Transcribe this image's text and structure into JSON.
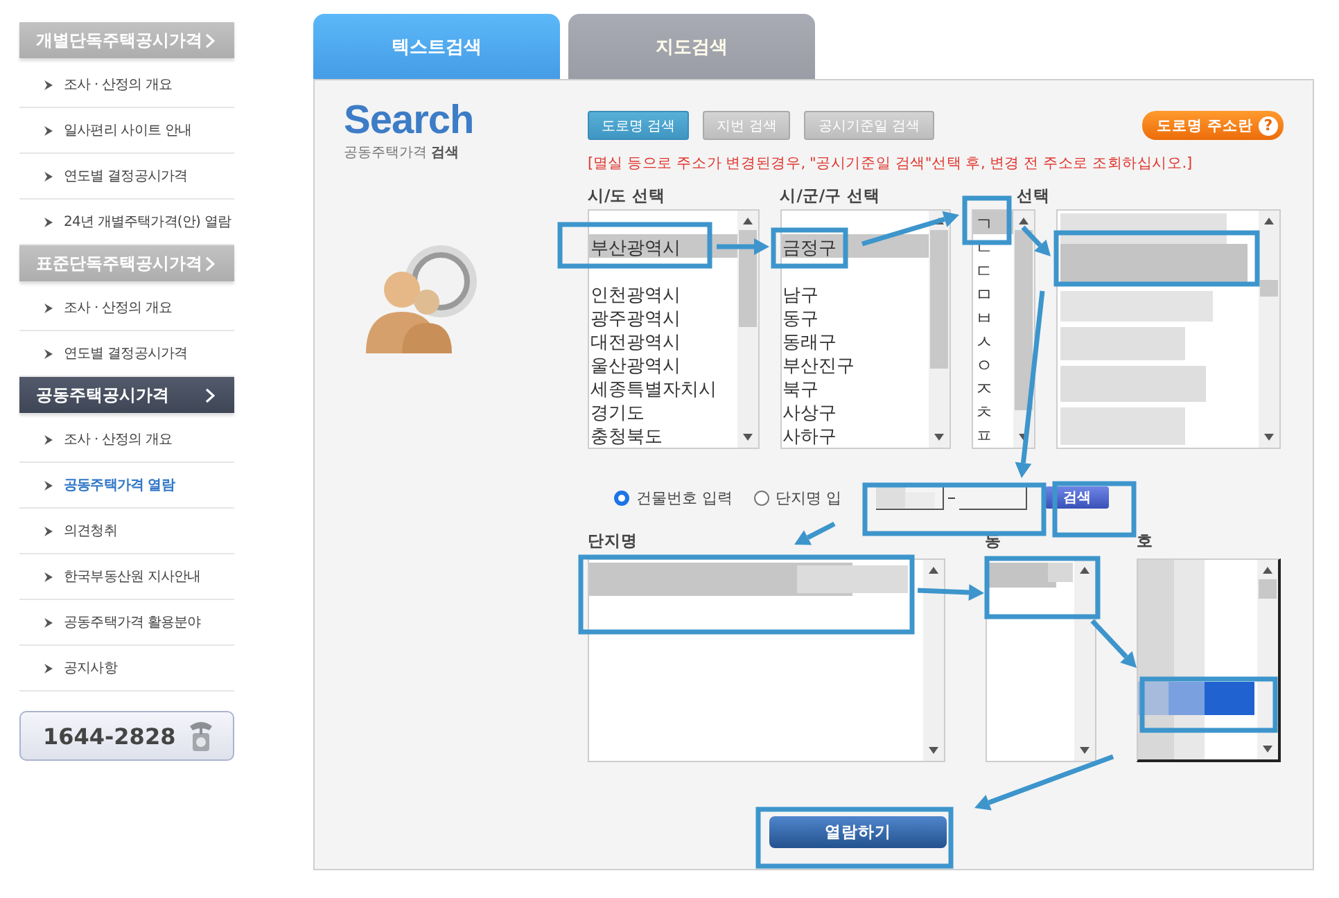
{
  "sidebar": {
    "sections": [
      {
        "title": "개별단독주택공시가격",
        "active": false,
        "items": [
          {
            "label": "조사 · 산정의 개요",
            "selected": false
          },
          {
            "label": "일사편리 사이트 안내",
            "selected": false
          },
          {
            "label": "연도별 결정공시가격",
            "selected": false
          },
          {
            "label": "24년 개별주택가격(안) 열람",
            "selected": false
          }
        ]
      },
      {
        "title": "표준단독주택공시가격",
        "active": false,
        "items": [
          {
            "label": "조사 · 산정의 개요",
            "selected": false
          },
          {
            "label": "연도별 결정공시가격",
            "selected": false
          }
        ]
      },
      {
        "title": "공동주택공시가격",
        "active": true,
        "items": [
          {
            "label": "조사 · 산정의 개요",
            "selected": false
          },
          {
            "label": "공동주택가격 열람",
            "selected": true
          },
          {
            "label": "의견청취",
            "selected": false
          },
          {
            "label": "한국부동산원 지사안내",
            "selected": false
          },
          {
            "label": "공동주택가격 활용분야",
            "selected": false
          },
          {
            "label": "공지사항",
            "selected": false
          }
        ]
      }
    ],
    "phone": "1644-2828"
  },
  "tabs": [
    {
      "label": "텍스트검색",
      "selected": true
    },
    {
      "label": "지도검색",
      "selected": false
    }
  ],
  "search_logo": {
    "title": "Search",
    "subtitle": "공동주택가격 **검색**"
  },
  "search_modes": [
    {
      "label": "도로명 검색",
      "selected": true
    },
    {
      "label": "지번 검색",
      "selected": false
    },
    {
      "label": "공시기준일 검색",
      "selected": false
    }
  ],
  "road_address_button": {
    "label": "도로명 주소란",
    "help": "?"
  },
  "notice": "[멸실 등으로 주소가 변경된경우, \"공시기준일 검색\"선택 후, 변경 전 주소로 조회하십시오.]",
  "address_lists": [
    {
      "label": "시/도 선택",
      "kind": "text",
      "items": [
        {
          "kind": "covered",
          "selected": false
        },
        {
          "kind": "text",
          "label": "부산광역시",
          "selected": true
        },
        {
          "kind": "covered",
          "selected": false
        },
        {
          "kind": "text",
          "label": "인천광역시",
          "selected": false
        },
        {
          "kind": "text",
          "label": "광주광역시",
          "selected": false
        },
        {
          "kind": "text",
          "label": "대전광역시",
          "selected": false
        },
        {
          "kind": "text",
          "label": "울산광역시",
          "selected": false
        },
        {
          "kind": "text",
          "label": "세종특별자치시",
          "selected": false
        },
        {
          "kind": "text",
          "label": "경기도",
          "selected": false
        },
        {
          "kind": "text",
          "label": "충청북도",
          "selected": false
        }
      ]
    },
    {
      "label": "시/군/구 선택",
      "kind": "text",
      "items": [
        {
          "kind": "covered",
          "selected": false
        },
        {
          "kind": "text",
          "label": "금정구",
          "selected": true
        },
        {
          "kind": "covered",
          "selected": false
        },
        {
          "kind": "text",
          "label": "남구",
          "selected": false
        },
        {
          "kind": "text",
          "label": "동구",
          "selected": false
        },
        {
          "kind": "text",
          "label": "동래구",
          "selected": false
        },
        {
          "kind": "text",
          "label": "부산진구",
          "selected": false
        },
        {
          "kind": "text",
          "label": "북구",
          "selected": false
        },
        {
          "kind": "text",
          "label": "사상구",
          "selected": false
        },
        {
          "kind": "text",
          "label": "사하구",
          "selected": false
        }
      ]
    },
    {
      "label": "선택",
      "kind": "text",
      "items": [
        {
          "kind": "text",
          "label": "ㄱ",
          "selected": true
        },
        {
          "kind": "text",
          "label": "ㄴ",
          "selected": false
        },
        {
          "kind": "text",
          "label": "ㄷ",
          "selected": false
        },
        {
          "kind": "text",
          "label": "ㅁ",
          "selected": false
        },
        {
          "kind": "text",
          "label": "ㅂ",
          "selected": false
        },
        {
          "kind": "text",
          "label": "ㅅ",
          "selected": false
        },
        {
          "kind": "text",
          "label": "ㅇ",
          "selected": false
        },
        {
          "kind": "text",
          "label": "ㅈ",
          "selected": false
        },
        {
          "kind": "text",
          "label": "ㅊ",
          "selected": false
        },
        {
          "kind": "text",
          "label": "ㅍ",
          "selected": false
        }
      ]
    },
    {
      "kind": "redacted"
    }
  ],
  "input_modes": [
    {
      "label": "건물번호 입력",
      "selected": true
    },
    {
      "label": "단지명 입",
      "selected": false
    }
  ],
  "search_button": "검색",
  "result_lists": [
    {
      "label": "단지명",
      "kind": "redacted"
    },
    {
      "label": "동",
      "kind": "redacted"
    },
    {
      "label": "호",
      "kind": "redacted"
    }
  ],
  "view_button": "열람하기"
}
